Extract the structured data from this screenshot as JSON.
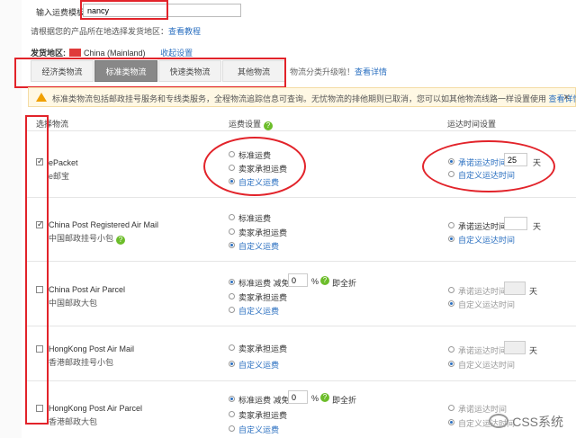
{
  "template": {
    "label": "输入运费模板名称:",
    "value": "nancy"
  },
  "hint": {
    "text": "请根据您的产品所在地选择发货地区：",
    "link": "查看教程"
  },
  "origin": {
    "label": "发货地区:",
    "country": "China (Mainland)",
    "collapse": "收起设置"
  },
  "tabs": [
    "经济类物流",
    "标准类物流",
    "快速类物流",
    "其他物流"
  ],
  "tab_note": {
    "text": "物流分类升级啦！",
    "link": "查看详情"
  },
  "alert": {
    "text": "标准类物流包括邮政挂号服务和专线类服务，全程物流追踪信息可查询。无忧物流的排他期则已取消，您可以如其他物流线路一样设置使用",
    "link": "查看详情",
    "close": "×"
  },
  "headers": {
    "select": "选择物流",
    "shipping": "运费设置",
    "delivery": "运达时间设置"
  },
  "options": {
    "standard": "标准运费",
    "seller": "卖家承担运费",
    "custom": "自定义运费",
    "discount_label": "减免",
    "percent": "%",
    "full_price": "即全折",
    "promise": "承诺运达时间",
    "day": "天",
    "custom_time": "自定义运达时间"
  },
  "services": [
    {
      "name": "ePacket",
      "sub": "e邮宝",
      "checked": true,
      "days": "25"
    },
    {
      "name": "China Post Registered Air Mail",
      "sub": "中国邮政挂号小包",
      "checked": true,
      "days": ""
    },
    {
      "name": "China Post Air Parcel",
      "sub": "中国邮政大包",
      "checked": false,
      "discount": "0",
      "days": ""
    },
    {
      "name": "HongKong Post Air Mail",
      "sub": "香港邮政挂号小包",
      "checked": false,
      "days": ""
    },
    {
      "name": "HongKong Post Air Parcel",
      "sub": "香港邮政大包",
      "checked": false,
      "discount": "0",
      "days": ""
    }
  ],
  "watermark": "CSS系统",
  "colors": {
    "annotation_red": "#e2232a",
    "link_blue": "#2a6fc0",
    "active_tab": "#888888",
    "alert_bg": "#fff8e4",
    "help_green": "#6cbd2a"
  }
}
